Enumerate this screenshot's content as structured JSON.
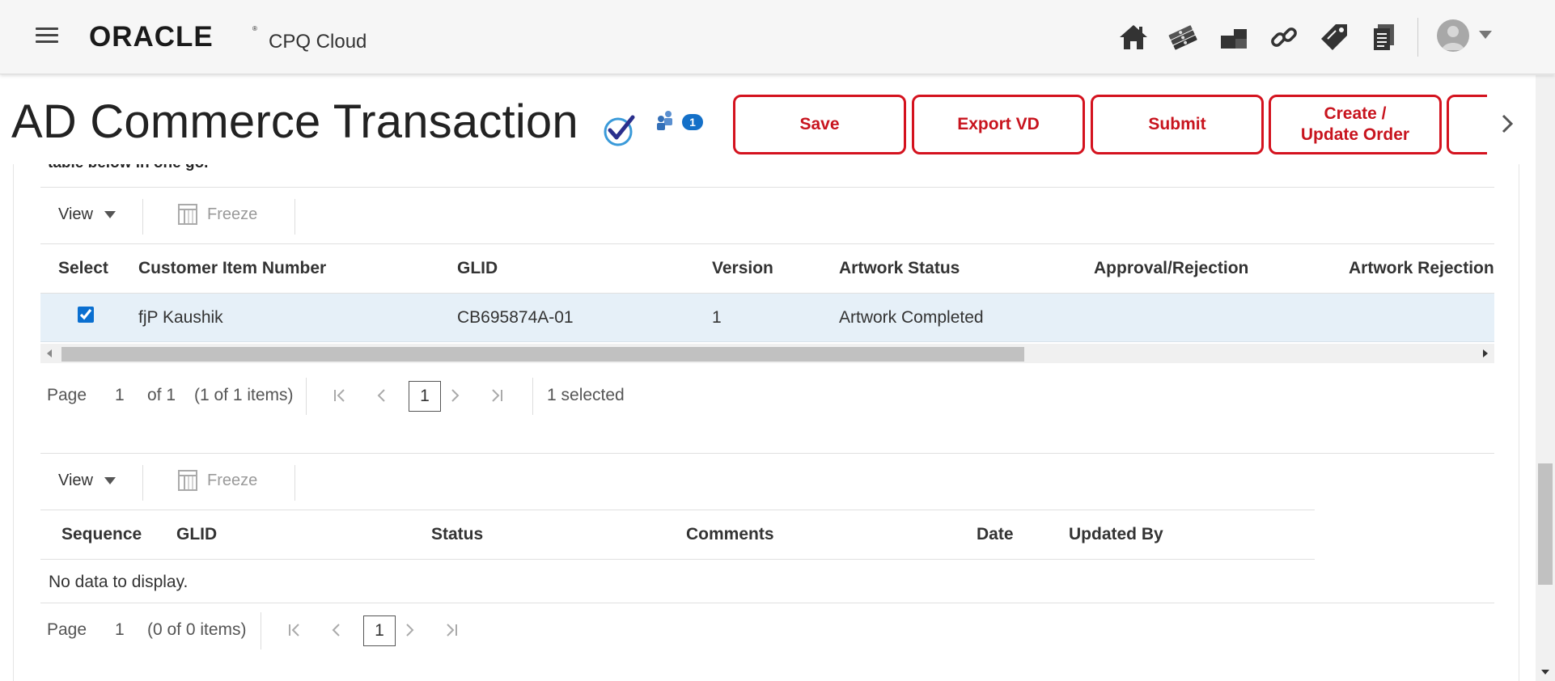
{
  "app": {
    "brand": "ORACLE",
    "product": "CPQ Cloud"
  },
  "topbar": {
    "icons": [
      "home-icon",
      "money-icon",
      "boxes-icon",
      "link-icon",
      "price-tag-icon",
      "documents-icon"
    ],
    "user_icon": "user-avatar-icon"
  },
  "header": {
    "title": "AD Commerce Transaction",
    "notification_count": "1",
    "buttons": {
      "save": "Save",
      "export": "Export VD",
      "submit": "Submit",
      "create_update_1": "Create /",
      "create_update_2": "Update Order"
    }
  },
  "section_cut_text": "table below in one go.",
  "table1": {
    "toolbar": {
      "view": "View",
      "freeze": "Freeze"
    },
    "columns": [
      "Select",
      "Customer Item Number",
      "GLID",
      "Version",
      "Artwork Status",
      "Approval/Rejection",
      "Artwork Rejection"
    ],
    "rows": [
      {
        "selected": true,
        "customer_item_number": "fjP Kaushik",
        "glid": "CB695874A-01",
        "version": "1",
        "artwork_status": "Artwork Completed",
        "approval_rejection": "",
        "artwork_rejection": ""
      }
    ],
    "pager": {
      "page_label": "Page",
      "page_value": "1",
      "of_label": "of 1",
      "items_label": "(1 of 1 items)",
      "current_page": "1",
      "selected_label": "1 selected"
    }
  },
  "table2": {
    "toolbar": {
      "view": "View",
      "freeze": "Freeze"
    },
    "columns": [
      "Sequence",
      "GLID",
      "Status",
      "Comments",
      "Date",
      "Updated By"
    ],
    "empty_text": "No data to display.",
    "pager": {
      "page_label": "Page",
      "page_value": "1",
      "items_label": "(0 of 0 items)",
      "current_page": "1"
    }
  },
  "colors": {
    "accent_red": "#d4121e",
    "badge_blue": "#1470c8",
    "row_selected": "#e6f0f8"
  }
}
